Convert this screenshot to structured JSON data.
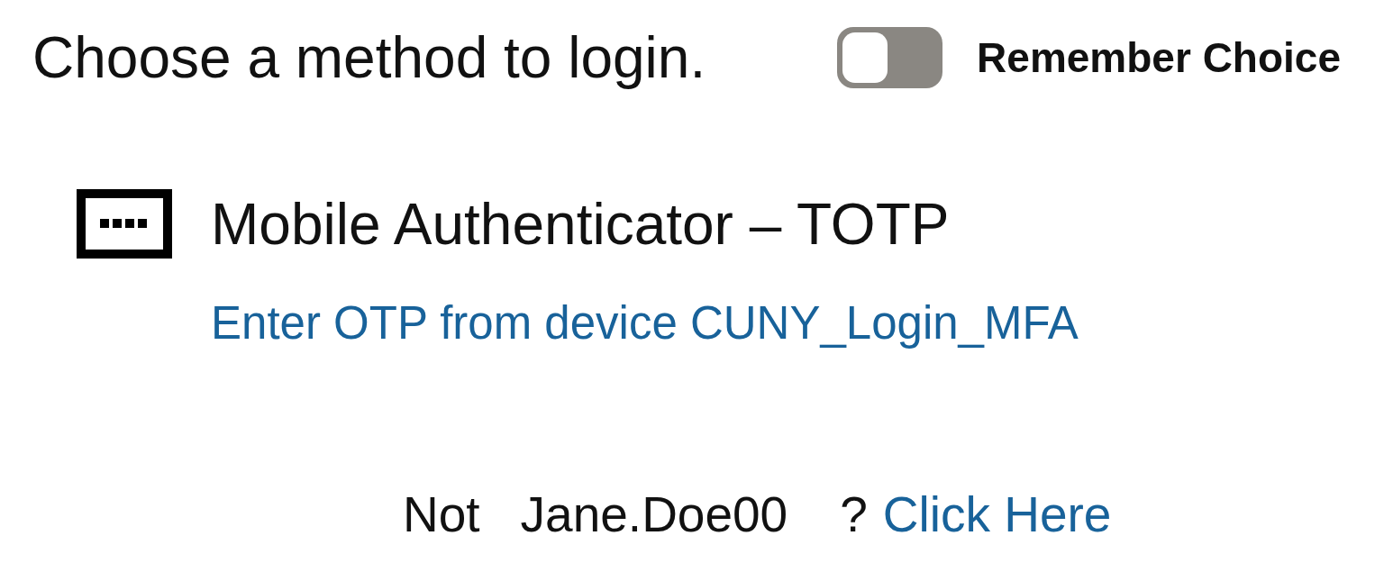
{
  "header": {
    "title": "Choose a method to login.",
    "remember_choice": {
      "label": "Remember Choice",
      "on": false
    }
  },
  "methods": [
    {
      "title": "Mobile Authenticator – TOTP",
      "description": "Enter OTP from device CUNY_Login_MFA"
    }
  ],
  "footer": {
    "prefix": "Not",
    "username": "Jane.Doe00",
    "suffix": "?",
    "link": "Click Here"
  }
}
